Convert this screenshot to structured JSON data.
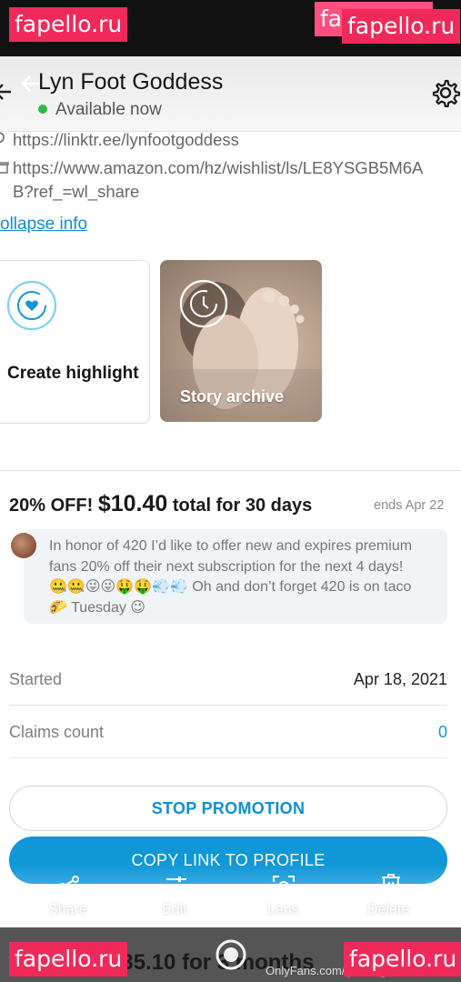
{
  "watermarks": {
    "top_left": "fapello.ru",
    "top_right_back": "fapello.ru",
    "top_right_front": "fapello.ru",
    "bottom_left": "fapello.ru",
    "bottom_right": "fapello.ru"
  },
  "header": {
    "title": "Lyn Foot Goddess",
    "status": "Available now",
    "status_color": "#2fb84c"
  },
  "links": {
    "linktree": "https://linktr.ee/lynfootgoddess",
    "amazon_line1": "https://www.amazon.com/hz/wishlist/ls/LE8YSGB5M6A",
    "amazon_line2": "B?ref_=wl_share",
    "collapse": "ollapse info"
  },
  "highlights": {
    "create_label": "Create highlight",
    "story_label": "Story archive"
  },
  "promotion": {
    "discount": "20% OFF!",
    "price": "$10.40",
    "duration": "total for 30 days",
    "ends": "ends Apr 22",
    "message_line1": "In honor of 420 I’d like to offer new and expires premium",
    "message_line2": "fans 20% off their next subscription for the next 4 days!",
    "message_line3": "🤐🤐😜😜🤑🤑💨💨 Oh and don’t forget 420 is on taco",
    "message_line4": "🌮 Tuesday 😉",
    "started_label": "Started",
    "started_value": "Apr 18, 2021",
    "claims_label": "Claims count",
    "claims_value": "0",
    "stop_button": "STOP PROMOTION",
    "copy_button": "COPY LINK TO PROFILE"
  },
  "toolbar": {
    "share": "Share",
    "edit": "Edit",
    "lens": "Lens",
    "delete": "Delete"
  },
  "footer": {
    "next_promo": "$35.10 for 3 months",
    "credit": "OnlyFans.com/lynfootgoddess"
  },
  "colors": {
    "accent": "#0f97d8",
    "watermark": "#ef2a5b"
  }
}
